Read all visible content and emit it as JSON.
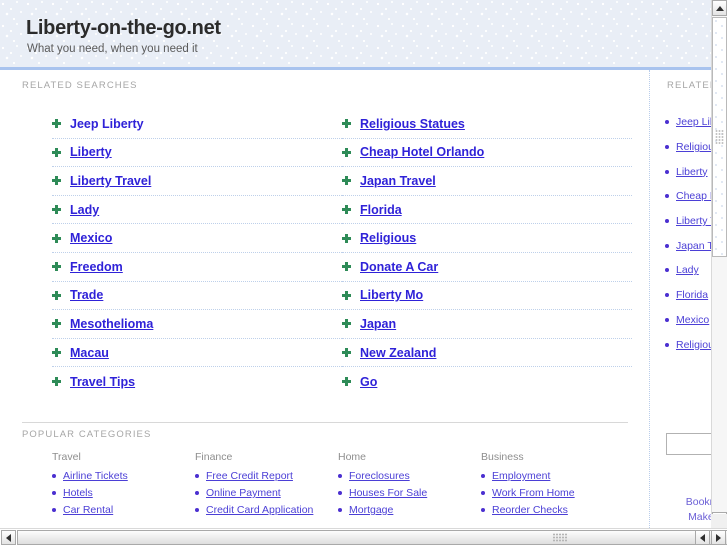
{
  "header": {
    "title": "Liberty-on-the-go.net",
    "tagline": "What you need, when you need it"
  },
  "related_searches": {
    "label": "RELATED SEARCHES",
    "columns": [
      {
        "items": [
          {
            "label": "Jeep Liberty",
            "underlined": false
          },
          {
            "label": "Liberty",
            "underlined": true
          },
          {
            "label": "Liberty Travel",
            "underlined": true
          },
          {
            "label": "Lady",
            "underlined": true
          },
          {
            "label": "Mexico",
            "underlined": true
          },
          {
            "label": "Freedom",
            "underlined": true
          },
          {
            "label": "Trade",
            "underlined": true
          },
          {
            "label": "Mesothelioma",
            "underlined": true
          },
          {
            "label": "Macau",
            "underlined": true
          },
          {
            "label": "Travel Tips",
            "underlined": true
          }
        ]
      },
      {
        "items": [
          {
            "label": "Religious Statues",
            "underlined": true
          },
          {
            "label": "Cheap Hotel Orlando",
            "underlined": true
          },
          {
            "label": "Japan Travel",
            "underlined": true
          },
          {
            "label": "Florida",
            "underlined": true
          },
          {
            "label": "Religious",
            "underlined": true
          },
          {
            "label": "Donate A Car",
            "underlined": true
          },
          {
            "label": "Liberty Mo",
            "underlined": true
          },
          {
            "label": "Japan",
            "underlined": true
          },
          {
            "label": "New Zealand",
            "underlined": true
          },
          {
            "label": "Go",
            "underlined": true
          }
        ]
      }
    ]
  },
  "popular_categories": {
    "label": "POPULAR CATEGORIES",
    "columns": [
      {
        "heading": "Travel",
        "links": [
          "Airline Tickets",
          "Hotels",
          "Car Rental"
        ]
      },
      {
        "heading": "Finance",
        "links": [
          "Free Credit Report",
          "Online Payment",
          "Credit Card Application"
        ]
      },
      {
        "heading": "Home",
        "links": [
          "Foreclosures",
          "Houses For Sale",
          "Mortgage"
        ]
      },
      {
        "heading": "Business",
        "links": [
          "Employment",
          "Work From Home",
          "Reorder Checks"
        ]
      }
    ]
  },
  "sidebar": {
    "label": "RELATED SEARCHES",
    "items": [
      "Jeep Liberty",
      "Religious Statues",
      "Liberty",
      "Cheap Hotel Orlando",
      "Liberty Travel",
      "Japan Travel",
      "Lady",
      "Florida",
      "Mexico",
      "Religious"
    ],
    "search_value": "",
    "footer_links": [
      "Bookmark",
      "Make this"
    ]
  },
  "colors": {
    "header_bg": "#e9eef6",
    "header_border": "#a8c3ee",
    "link": "#2f22d8",
    "bullet_green": "#2e8b57",
    "bullet_purple": "#4b2fd0",
    "label_grey": "#a6a6a6"
  },
  "scrollbars": {
    "v_up_icon": "arrow-up-icon",
    "v_down_icon": "arrow-down-icon",
    "h_left_icon": "arrow-left-icon",
    "h_right_icon": "arrow-right-icon"
  }
}
